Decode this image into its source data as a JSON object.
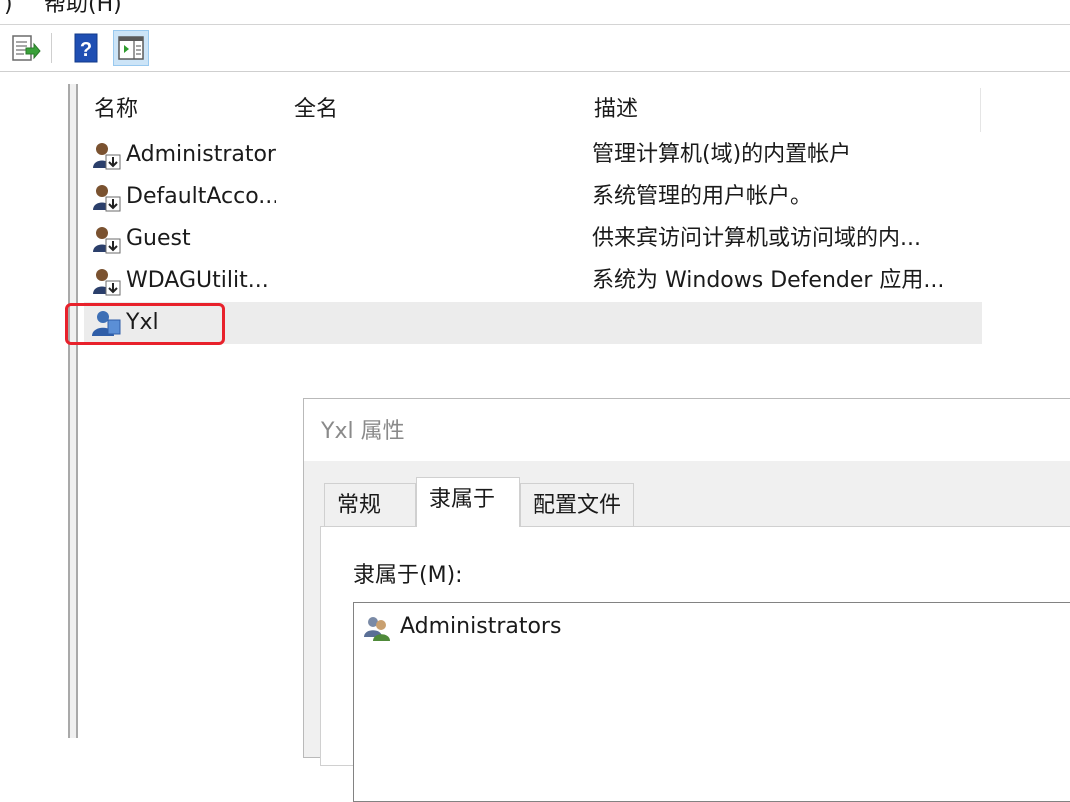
{
  "menu": {
    "items": [
      ")",
      "帮助(H)"
    ]
  },
  "toolbar": {
    "buttons": [
      "export-list-icon",
      "help-icon",
      "show-hide-action-pane-icon"
    ]
  },
  "list": {
    "columns": [
      "名称",
      "全名",
      "描述"
    ],
    "rows": [
      {
        "name": "Administrator",
        "fullname": "",
        "description": "管理计算机(域)的内置帐户",
        "icon": "user-disabled-icon"
      },
      {
        "name": "DefaultAcco...",
        "fullname": "",
        "description": "系统管理的用户帐户。",
        "icon": "user-disabled-icon"
      },
      {
        "name": "Guest",
        "fullname": "",
        "description": "供来宾访问计算机或访问域的内...",
        "icon": "user-disabled-icon"
      },
      {
        "name": "WDAGUtilit...",
        "fullname": "",
        "description": "系统为 Windows Defender 应用...",
        "icon": "user-disabled-icon"
      },
      {
        "name": "Yxl",
        "fullname": "",
        "description": "",
        "icon": "user-icon"
      }
    ]
  },
  "dialog": {
    "title": "Yxl 属性",
    "tabs": [
      "常规",
      "隶属于",
      "配置文件"
    ],
    "active_tab": "隶属于",
    "member_of_label": "隶属于(M):",
    "members": [
      "Administrators"
    ]
  },
  "colors": {
    "highlight": "#e8212b",
    "selected_row": "#ececec",
    "active_toolbar": "#cce4f7"
  }
}
